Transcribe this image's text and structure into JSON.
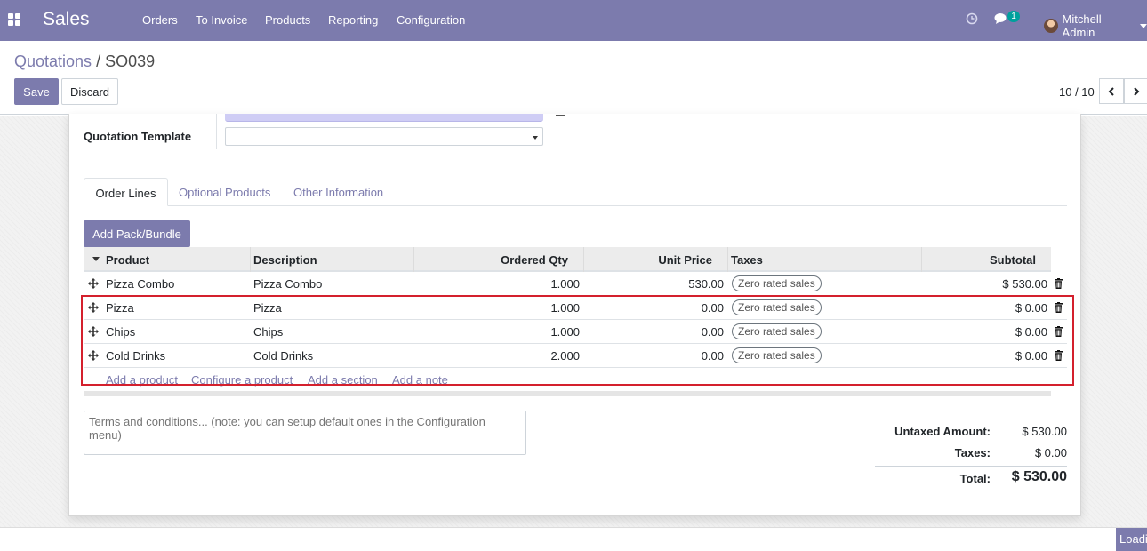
{
  "navbar": {
    "brand": "Sales",
    "menu": [
      "Orders",
      "To Invoice",
      "Products",
      "Reporting",
      "Configuration"
    ],
    "chat_badge": "1",
    "user_name": "Mitchell Admin"
  },
  "breadcrumb": {
    "parent": "Quotations",
    "separator": "/",
    "current": "SO039"
  },
  "toolbar": {
    "save_label": "Save",
    "discard_label": "Discard"
  },
  "pager": {
    "text": "10 / 10"
  },
  "form": {
    "quotation_template_label": "Quotation Template",
    "quotation_template_value": ""
  },
  "tabs": [
    "Order Lines",
    "Optional Products",
    "Other Information"
  ],
  "add_pack_label": "Add Pack/Bundle",
  "table": {
    "headers": [
      "Product",
      "Description",
      "Ordered Qty",
      "Unit Price",
      "Taxes",
      "Subtotal"
    ],
    "rows": [
      {
        "product": "Pizza Combo",
        "description": "Pizza Combo",
        "qty": "1.000",
        "unit_price": "530.00",
        "tax": "Zero rated sales",
        "subtotal": "$ 530.00"
      },
      {
        "product": "Pizza",
        "description": "Pizza",
        "qty": "1.000",
        "unit_price": "0.00",
        "tax": "Zero rated sales",
        "subtotal": "$ 0.00"
      },
      {
        "product": "Chips",
        "description": "Chips",
        "qty": "1.000",
        "unit_price": "0.00",
        "tax": "Zero rated sales",
        "subtotal": "$ 0.00"
      },
      {
        "product": "Cold Drinks",
        "description": "Cold Drinks",
        "qty": "2.000",
        "unit_price": "0.00",
        "tax": "Zero rated sales",
        "subtotal": "$ 0.00"
      }
    ],
    "add_links": [
      "Add a product",
      "Configure a product",
      "Add a section",
      "Add a note"
    ]
  },
  "terms_placeholder": "Terms and conditions... (note: you can setup default ones in the Configuration menu)",
  "totals": {
    "untaxed_label": "Untaxed Amount:",
    "untaxed_value": "$ 530.00",
    "taxes_label": "Taxes:",
    "taxes_value": "$ 0.00",
    "total_label": "Total:",
    "total_value": "$ 530.00"
  },
  "loading_text": "Loading",
  "colors": {
    "brand": "#7c7bad",
    "highlight": "#d4202d",
    "chat_badge": "#00a09d"
  }
}
